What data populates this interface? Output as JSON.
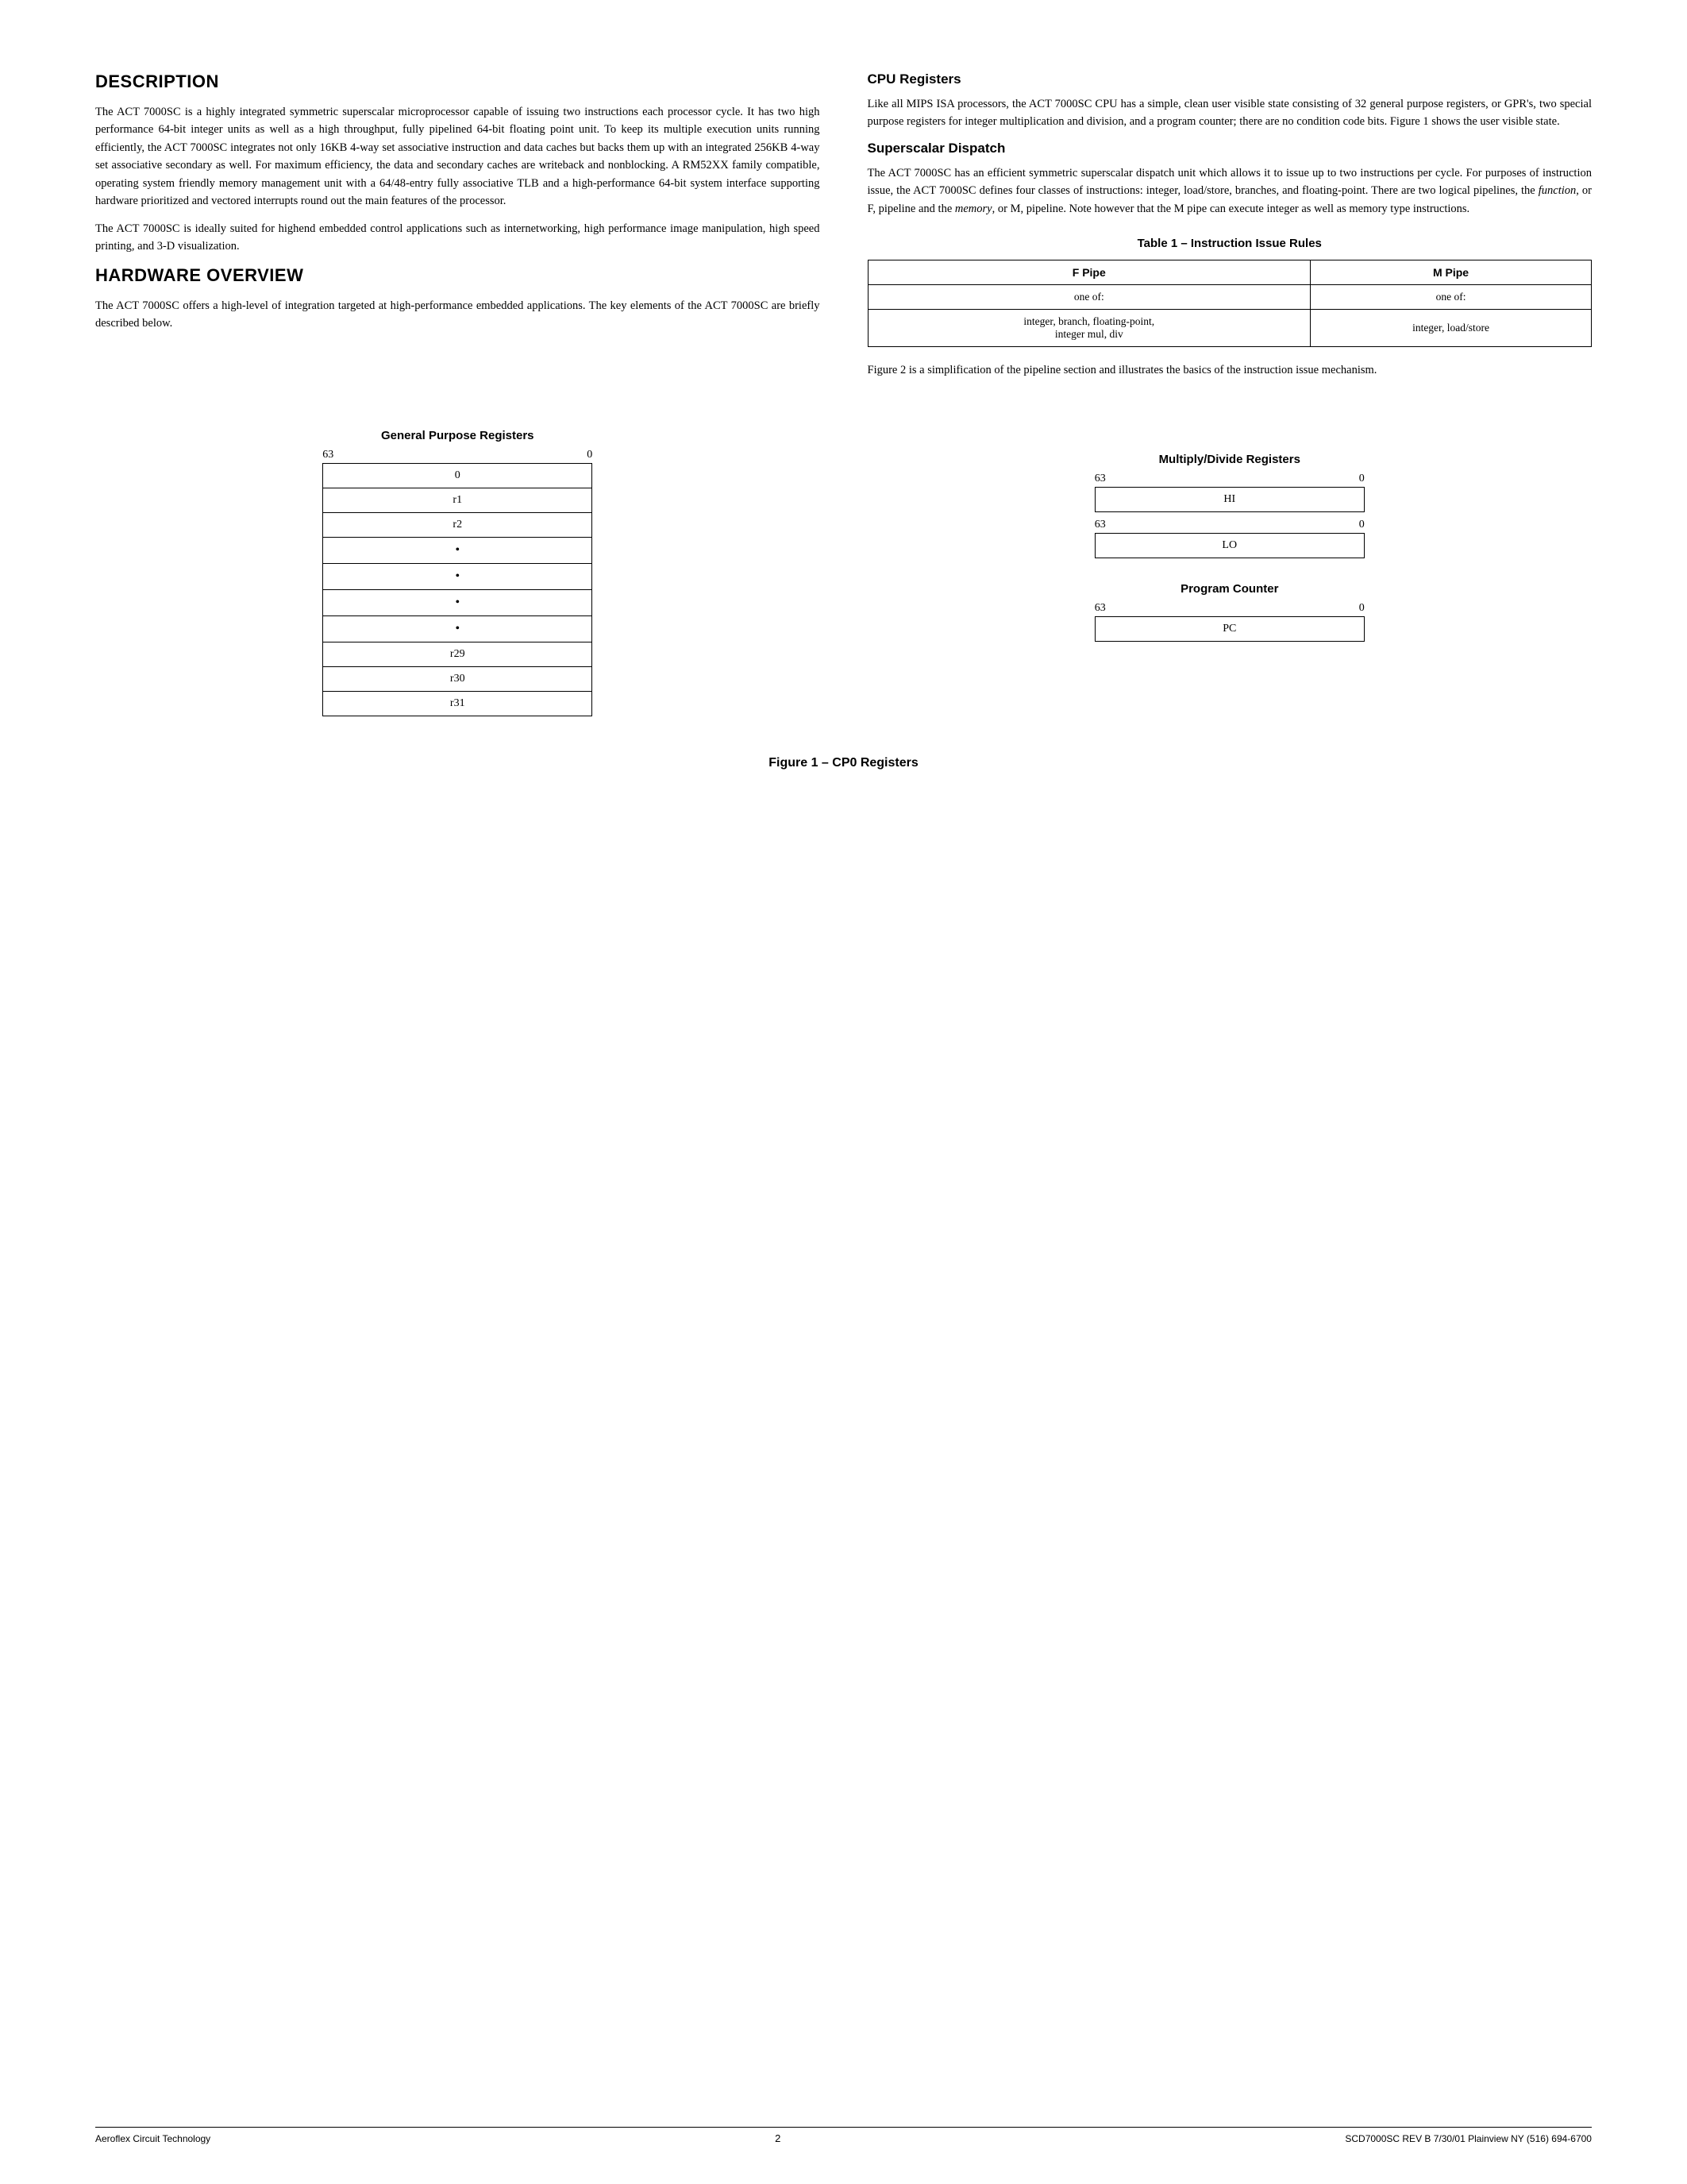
{
  "page": {
    "sections": {
      "description": {
        "title": "DESCRIPTION",
        "paragraphs": [
          "The ACT 7000SC is a highly integrated symmetric superscalar microprocessor capable of issuing two instructions each processor cycle. It has two high performance 64-bit integer units as well as a high throughput, fully pipelined 64-bit floating point unit. To keep its multiple execution units running efficiently, the ACT 7000SC integrates not only 16KB 4-way set associative instruction and data caches but backs them up with an integrated 256KB 4-way set associative secondary as well. For maximum efficiency, the data and secondary caches are writeback and nonblocking. A RM52XX family compatible, operating system friendly memory management unit with a 64/48-entry fully associative TLB and a high-performance 64-bit system interface supporting hardware prioritized and vectored interrupts round out the main features of the processor.",
          "The ACT 7000SC is ideally suited for highend embedded control applications such as internetworking, high performance image manipulation, high speed printing, and 3-D visualization."
        ]
      },
      "hardware_overview": {
        "title": "HARDWARE OVERVIEW",
        "paragraph": "The ACT 7000SC offers a high-level of integration targeted at high-performance embedded applications. The key elements of the ACT 7000SC are briefly described below."
      },
      "cpu_registers": {
        "title": "CPU Registers",
        "paragraph": "Like all MIPS ISA processors, the ACT 7000SC CPU has a simple, clean user visible state consisting of 32 general purpose registers, or GPR's, two special purpose registers for integer multiplication and division, and a program counter; there are no condition code bits. Figure 1 shows the user visible state."
      },
      "superscalar_dispatch": {
        "title": "Superscalar Dispatch",
        "paragraph": "The ACT 7000SC has an efficient symmetric superscalar dispatch unit which allows it to issue up to two instructions per cycle. For purposes of instruction issue, the ACT 7000SC defines four classes of instructions: integer, load/store, branches, and floating-point. There are two logical pipelines, the function, or F, pipeline and the memory, or M, pipeline. Note however that the M pipe can execute integer as well as memory type instructions.",
        "italic_parts": [
          "function",
          "memory"
        ]
      },
      "table": {
        "title": "Table 1 – Instruction Issue Rules",
        "headers": [
          "F Pipe",
          "M Pipe"
        ],
        "row1": [
          "one of:",
          "one of:"
        ],
        "row2": [
          "integer, branch, floating-point,\ninteger mul, div",
          "integer, load/store"
        ]
      },
      "figure_note": "Figure 2 is a simplification of the pipeline section and illustrates the basics of the instruction issue mechanism."
    },
    "figure1": {
      "caption": "Figure 1 – CP0 Registers",
      "gpr": {
        "title": "General Purpose Registers",
        "range_high": "63",
        "range_low": "0",
        "rows": [
          "0",
          "r1",
          "r2",
          "•",
          "•",
          "•",
          "•",
          "r29",
          "r30",
          "r31"
        ]
      },
      "mdr": {
        "title": "Multiply/Divide Registers",
        "hi": {
          "range_high": "63",
          "range_low": "0",
          "label": "HI"
        },
        "lo": {
          "range_high": "63",
          "range_low": "0",
          "label": "LO"
        }
      },
      "pc": {
        "title": "Program Counter",
        "range_high": "63",
        "range_low": "0",
        "label": "PC"
      }
    },
    "footer": {
      "left": "Aeroflex Circuit Technology",
      "center": "2",
      "right": "SCD7000SC REV B  7/30/01  Plainview NY (516) 694-6700"
    }
  }
}
